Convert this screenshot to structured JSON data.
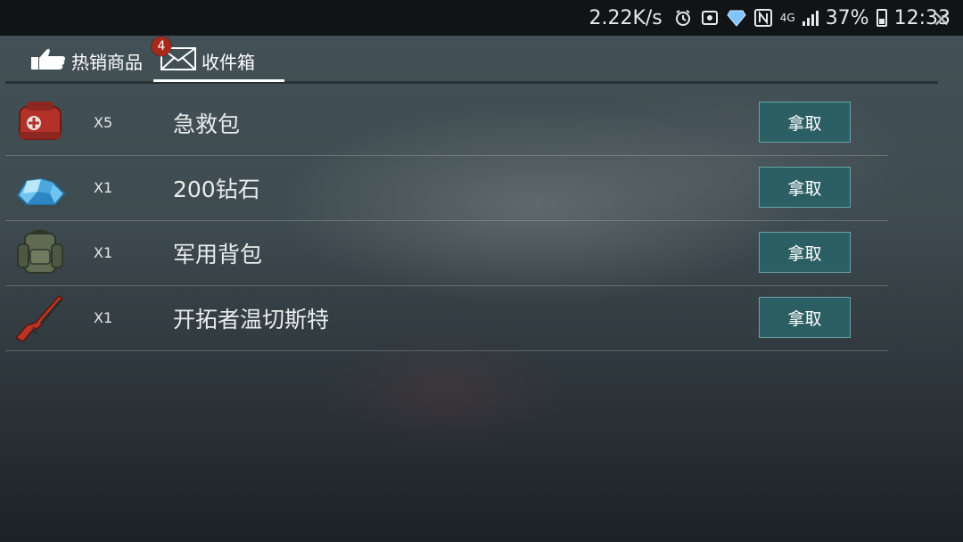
{
  "statusbar": {
    "speed": "2.22K/s",
    "network": "4G",
    "battery_pct": "37%",
    "time": "12:33",
    "icons": [
      "alarm-icon",
      "vpn-icon",
      "diamond-icon",
      "nfc-icon",
      "signal-icon",
      "battery-icon"
    ]
  },
  "tabs": [
    {
      "label": "热销商品",
      "icon": "thumbs-up-icon",
      "active": false
    },
    {
      "label": "收件箱",
      "icon": "envelope-icon",
      "active": true,
      "badge": "4"
    }
  ],
  "inbox": {
    "items": [
      {
        "icon": "first-aid-kit-icon",
        "qty": "X5",
        "name": "急救包",
        "action": "拿取"
      },
      {
        "icon": "diamond-pile-icon",
        "qty": "X1",
        "name": "200钻石",
        "action": "拿取"
      },
      {
        "icon": "military-backpack-icon",
        "qty": "X1",
        "name": "军用背包",
        "action": "拿取"
      },
      {
        "icon": "rifle-icon",
        "qty": "X1",
        "name": "开拓者温切斯特",
        "action": "拿取"
      }
    ]
  },
  "colors": {
    "take_button_bg": "#2c5f64",
    "take_button_border": "#6aa3a7",
    "badge": "#a8281c"
  }
}
